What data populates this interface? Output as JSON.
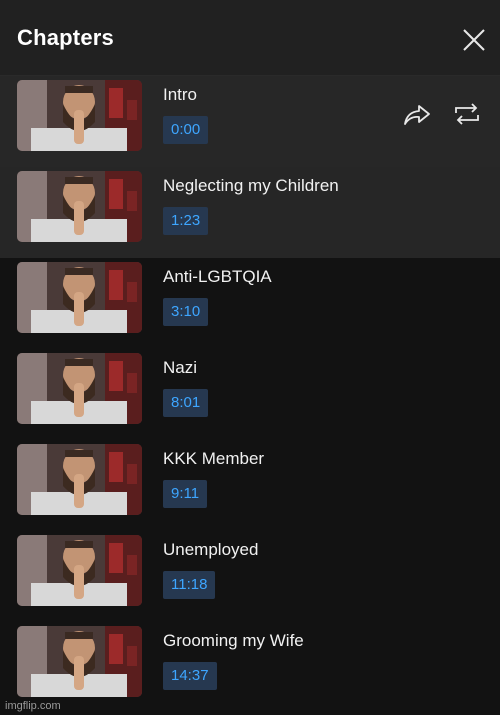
{
  "header": {
    "title": "Chapters",
    "close_icon": "close-icon"
  },
  "actions": {
    "share_icon": "share-icon",
    "loop_icon": "loop-icon"
  },
  "chapters": [
    {
      "title": "Intro",
      "time": "0:00"
    },
    {
      "title": "Neglecting my Children",
      "time": "1:23"
    },
    {
      "title": "Anti-LGBTQIA",
      "time": "3:10"
    },
    {
      "title": "Nazi",
      "time": "8:01"
    },
    {
      "title": "KKK Member",
      "time": "9:11"
    },
    {
      "title": "Unemployed",
      "time": "11:18"
    },
    {
      "title": "Grooming my Wife",
      "time": "14:37"
    }
  ],
  "colors": {
    "background": "#121212",
    "header": "#212121",
    "highlight": "#272727",
    "timestamp_text": "#3ea6ff",
    "timestamp_bg": "#263850"
  },
  "watermark": "imgflip.com"
}
